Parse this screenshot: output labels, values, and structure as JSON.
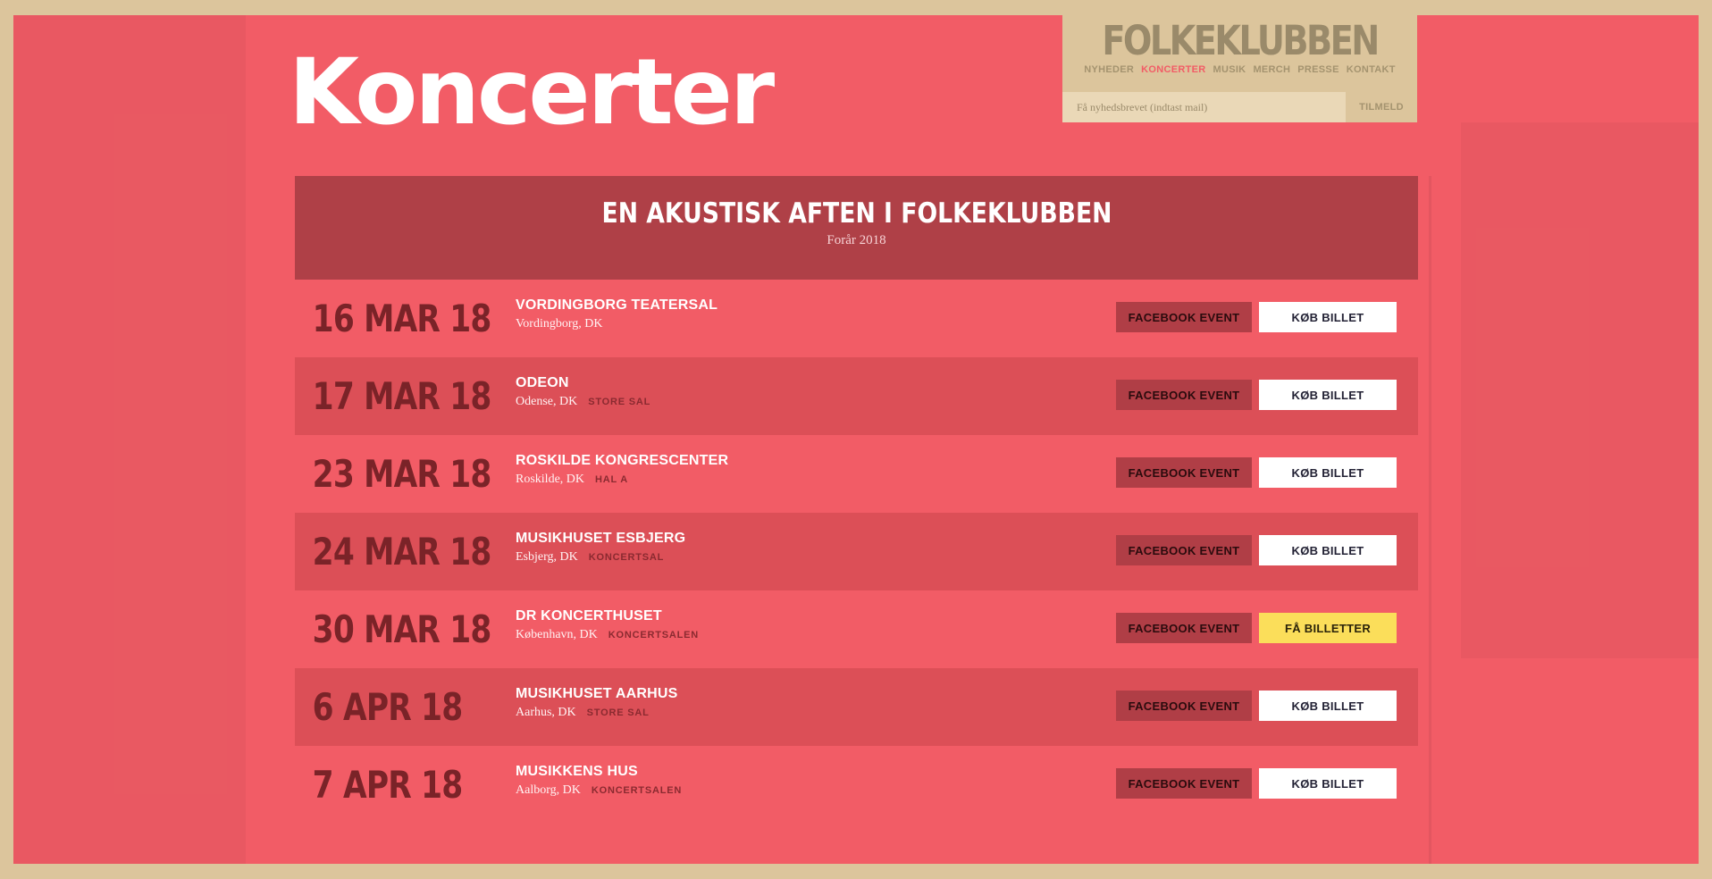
{
  "page": {
    "title": "Koncerter"
  },
  "brand": {
    "logo": "FOLKEKLUBBEN",
    "nav": [
      {
        "label": "NYHEDER"
      },
      {
        "label": "KONCERTER"
      },
      {
        "label": "MUSIK"
      },
      {
        "label": "MERCH"
      },
      {
        "label": "PRESSE"
      },
      {
        "label": "KONTAKT"
      }
    ],
    "active_nav": "KONCERTER",
    "newsletter": {
      "placeholder": "Få nyhedsbrevet (indtast mail)",
      "button_label": "TILMELD"
    }
  },
  "tour": {
    "title": "EN AKUSTISK AFTEN I FOLKEKLUBBEN",
    "subtitle": "Forår 2018"
  },
  "colors": {
    "background": "#f25c66",
    "frame": "#dcc59c",
    "header": "#af4047",
    "alt_row": "#dc4f57",
    "date_text": "#7a2328",
    "highlight_button": "#fbde5a"
  },
  "concerts": [
    {
      "date": "16 MAR 18",
      "venue": "VORDINGBORG TEATERSAL",
      "city": "Vordingborg, DK",
      "hall": "",
      "facebook_label": "FACEBOOK EVENT",
      "ticket_label": "KØB BILLET"
    },
    {
      "date": "17 MAR 18",
      "venue": "ODEON",
      "city": "Odense, DK",
      "hall": "STORE SAL",
      "facebook_label": "FACEBOOK EVENT",
      "ticket_label": "KØB BILLET"
    },
    {
      "date": "23 MAR 18",
      "venue": "ROSKILDE KONGRESCENTER",
      "city": "Roskilde, DK",
      "hall": "HAL A",
      "facebook_label": "FACEBOOK EVENT",
      "ticket_label": "KØB BILLET"
    },
    {
      "date": "24 MAR 18",
      "venue": "MUSIKHUSET ESBJERG",
      "city": "Esbjerg, DK",
      "hall": "KONCERTSAL",
      "facebook_label": "FACEBOOK EVENT",
      "ticket_label": "KØB BILLET"
    },
    {
      "date": "30 MAR 18",
      "venue": "DR KONCERTHUSET",
      "city": "København, DK",
      "hall": "KONCERTSALEN",
      "facebook_label": "FACEBOOK EVENT",
      "ticket_label": "FÅ BILLETTER"
    },
    {
      "date": "6 APR 18",
      "venue": "MUSIKHUSET AARHUS",
      "city": "Aarhus, DK",
      "hall": "STORE SAL",
      "facebook_label": "FACEBOOK EVENT",
      "ticket_label": "KØB BILLET"
    },
    {
      "date": "7 APR 18",
      "venue": "MUSIKKENS HUS",
      "city": "Aalborg, DK",
      "hall": "KONCERTSALEN",
      "facebook_label": "FACEBOOK EVENT",
      "ticket_label": "KØB BILLET"
    }
  ]
}
